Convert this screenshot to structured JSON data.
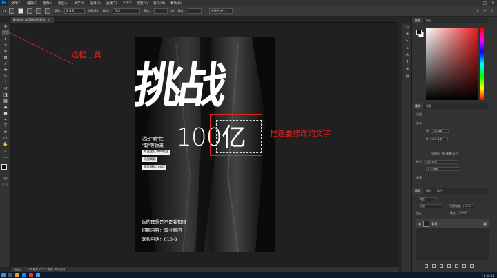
{
  "menubar": {
    "app_logo": "Ps",
    "items": [
      "文件(F)",
      "编辑(E)",
      "图像(I)",
      "图层(L)",
      "文字(Y)",
      "选择(S)",
      "滤镜(T)",
      "3D(D)",
      "视图(V)",
      "窗口(W)",
      "帮助(H)"
    ],
    "window_controls": [
      "minimize-icon",
      "maximize-icon",
      "close-icon"
    ]
  },
  "options_bar": {
    "feather_label": "羽化:",
    "feather_value": "0 像素",
    "antialias_label": "消除锯齿",
    "style_label": "样式:",
    "style_value": "正常",
    "width_label": "宽度:",
    "height_label": "高度:",
    "select_mask_button": "选择并遮住..."
  },
  "document": {
    "tab_title": "挑战.jpg @ 50%(RGB/8)",
    "close_glyph": "×"
  },
  "annotations": {
    "tool_label": "选框工具",
    "text_label": "框选要修改的文字"
  },
  "poster": {
    "headline": "挑战",
    "big_number": "100亿",
    "line1": "活出\"敢\"性",
    "line2": "\"取\"等你来",
    "tags": [
      "专业团队项目经理",
      "挑战高薪",
      "销售目标100亿"
    ],
    "footer1": "你的理想是不是我知道",
    "footer2": "招聘内容：置业顾问",
    "footer3": "联系电话：010-8"
  },
  "status_bar": {
    "zoom": "100%",
    "doc_size": "334 像素 x 512 像素 (96 ppi)"
  },
  "taskbar": {
    "clock": "16:00:12"
  },
  "panels": {
    "color_tabs": [
      "颜色",
      "色板"
    ],
    "properties_tabs": [
      "属性",
      "调整"
    ],
    "properties_label": "文档",
    "canvas_section": "画布",
    "w_label": "W",
    "w_value": "334 像素",
    "h_label": "H",
    "h_value": "512 像素",
    "resolution_label": "分辨率:",
    "resolution_value": "96 像素/英寸",
    "mode_label": "模式",
    "mode_value": "RGB 颜色",
    "depth_value": "8 位/通道",
    "bg_label": "背景",
    "layers_tabs": [
      "图层",
      "通道",
      "路径"
    ],
    "layer_kind": "类型",
    "blend_mode": "正常",
    "opacity_label": "不透明度:",
    "opacity_value": "100%",
    "lock_label": "锁定:",
    "fill_label": "填充:",
    "fill_value": "100%",
    "layer_name": "背景"
  },
  "colors": {
    "annotation_red": "#e02020",
    "ps_blue": "#31a8ff",
    "fg_color": "#111111",
    "bg_color": "#ffffff"
  }
}
